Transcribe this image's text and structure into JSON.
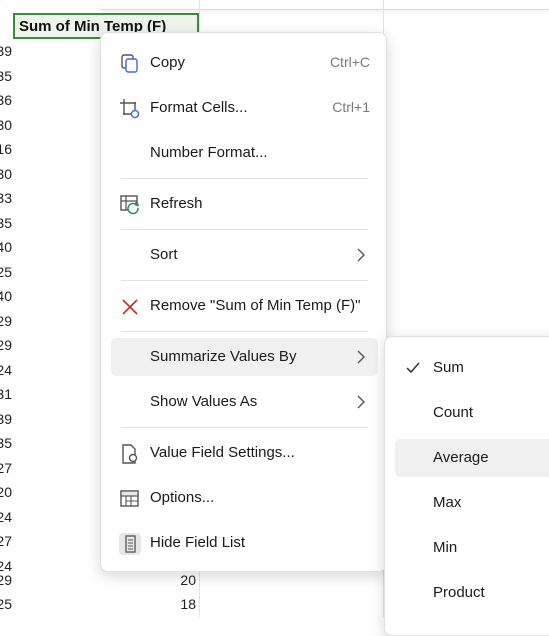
{
  "sheet": {
    "header": "Sum of Min Temp (F)",
    "left_values": [
      "39",
      "35",
      "36",
      "30",
      "16",
      "30",
      "33",
      "35",
      "40",
      "25",
      "40",
      "29",
      "29",
      "24",
      "31",
      "39",
      "35",
      "27",
      "20",
      "24",
      "27",
      "24",
      "29",
      "25"
    ],
    "right_values": [
      "20",
      "18"
    ]
  },
  "context_menu": {
    "items": [
      {
        "label": "Copy",
        "shortcut": "Ctrl+C"
      },
      {
        "label": "Format Cells...",
        "shortcut": "Ctrl+1"
      },
      {
        "label": "Number Format..."
      },
      {
        "label": "Refresh"
      },
      {
        "label": "Sort"
      },
      {
        "label": "Remove \"Sum of Min Temp (F)\""
      },
      {
        "label": "Summarize Values By"
      },
      {
        "label": "Show Values As"
      },
      {
        "label": "Value Field Settings..."
      },
      {
        "label": "Options..."
      },
      {
        "label": "Hide Field List"
      }
    ]
  },
  "submenu": {
    "items": [
      "Sum",
      "Count",
      "Average",
      "Max",
      "Min",
      "Product"
    ],
    "checked": "Sum",
    "highlighted": "Average"
  },
  "colors": {
    "header_border": "#3c8c3c",
    "remove_icon": "#c42b1c",
    "refresh_accent": "#2e8b57",
    "hover_bg": "#f0f0f0"
  }
}
